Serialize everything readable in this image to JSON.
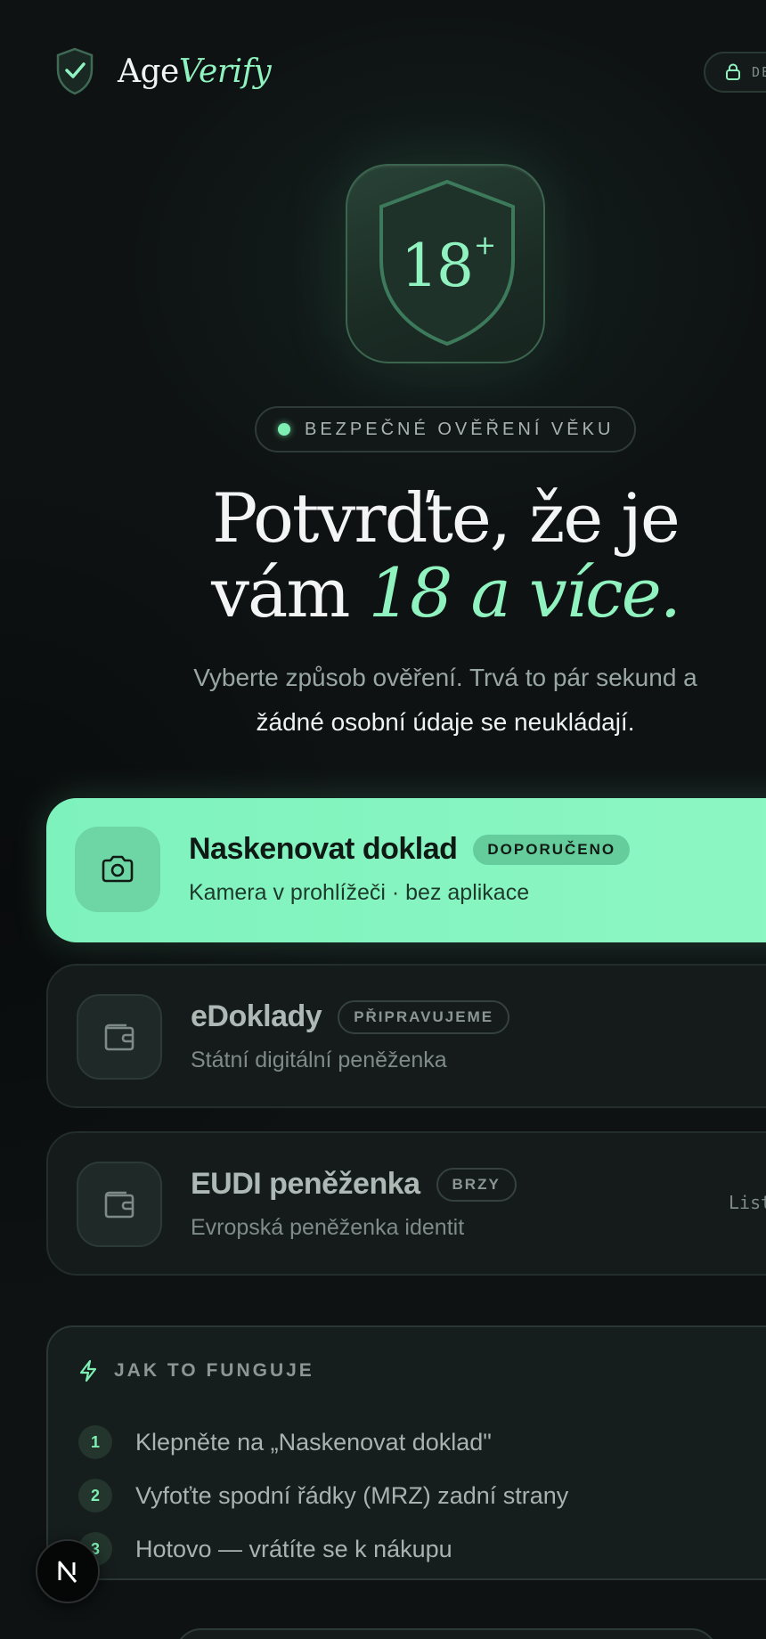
{
  "header": {
    "brand_prefix": "Age",
    "brand_suffix": "Verify",
    "lang_button": "DE",
    "icons": {
      "brand": "shield-check-icon",
      "lang": "lock-icon"
    }
  },
  "hero": {
    "badge_number": "18",
    "badge_plus": "+",
    "tag": "BEZPEČNÉ OVĚŘENÍ VĚKU",
    "headline_line1": "Potvrďte, že je",
    "headline_line2_plain": "vám ",
    "headline_line2_accent": "18 a více.",
    "subtitle_part1": "Vyberte způsob ověření. Trvá to pár sekund a",
    "subtitle_part2": "žádné osobní údaje se neukládají."
  },
  "options": [
    {
      "title": "Naskenovat doklad",
      "chip": "DOPORUČENO",
      "subtitle": "Kamera v prohlížeči · bez aplikace",
      "icon": "camera-icon"
    },
    {
      "title": "eDoklady",
      "chip": "PŘIPRAVUJEME",
      "subtitle": "Státní digitální peněženka",
      "icon": "wallet-icon"
    },
    {
      "title": "EUDI peněženka",
      "chip": "BRZY",
      "subtitle": "Evropská peněženka identit",
      "side_text": "List",
      "icon": "wallet-icon"
    }
  ],
  "how_it_works": {
    "title": "JAK TO FUNGUJE",
    "icon": "lightning-icon",
    "steps": [
      {
        "num": "1",
        "text": "Klepněte na „Naskenovat doklad\""
      },
      {
        "num": "2",
        "text": "Vyfoťte spodní řádky (MRZ) zadní strany"
      },
      {
        "num": "3",
        "text": "Hotovo — vrátíte se k nákupu"
      }
    ]
  },
  "floating_badge": {
    "label": "N"
  },
  "colors": {
    "background": "#0e1213",
    "accent": "#8ff2bf",
    "primary_card": "#7ef2bd",
    "card": "#151b1b",
    "muted_text": "#9aa6a2"
  }
}
